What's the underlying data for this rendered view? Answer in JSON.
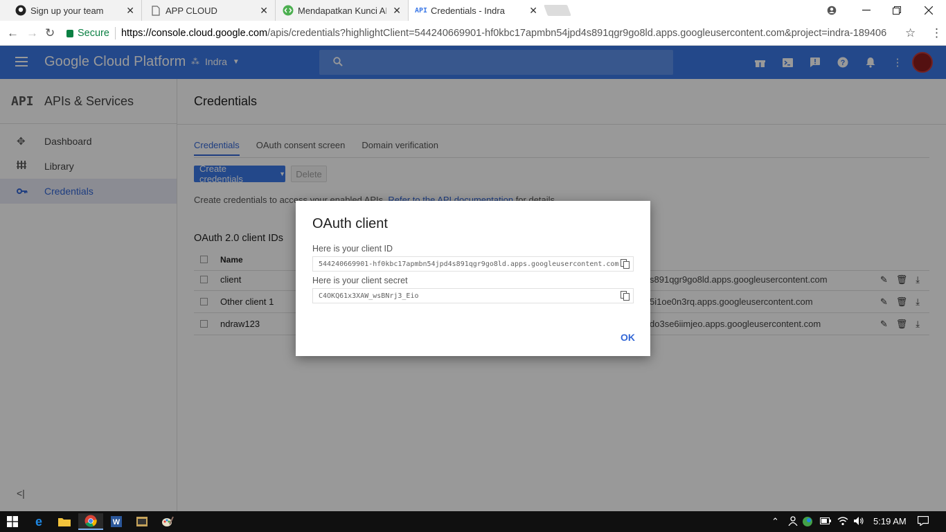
{
  "browser": {
    "tabs": [
      {
        "title": "Sign up your team",
        "icon": "github-icon"
      },
      {
        "title": "APP CLOUD",
        "icon": "document-icon"
      },
      {
        "title": "Mendapatkan Kunci API",
        "icon": "google-dev-icon"
      },
      {
        "title": "Credentials - Indra",
        "icon": "api-icon",
        "active": true
      }
    ],
    "tab_close": "✕",
    "secure_label": "Secure",
    "url_host": "https://console.cloud.google.com",
    "url_rest": "/apis/credentials?highlightClient=544240669901-hf0kbc17apmbn54jpd4s891qgr9go8ld.apps.googleusercontent.com&project=indra-189406"
  },
  "header": {
    "title": "Google Cloud Platform",
    "project": "Indra",
    "accent_color": "#3b78e7"
  },
  "sidebar": {
    "api_badge": "API",
    "title": "APIs & Services",
    "items": [
      {
        "label": "Dashboard",
        "icon": "dashboard-icon"
      },
      {
        "label": "Library",
        "icon": "library-icon"
      },
      {
        "label": "Credentials",
        "icon": "key-icon",
        "active": true
      }
    ]
  },
  "main": {
    "title": "Credentials",
    "tabs": [
      "Credentials",
      "OAuth consent screen",
      "Domain verification"
    ],
    "create_button": "Create credentials",
    "delete_button": "Delete",
    "help_prefix": "Create credentials to access your enabled APIs.",
    "help_link": "Refer to the API documentation",
    "help_suffix": "for details.",
    "section_title": "OAuth 2.0 client IDs",
    "table": {
      "header": "Name",
      "rows": [
        {
          "name": "client",
          "client_id": "s891qgr9go8ld.apps.googleusercontent.com"
        },
        {
          "name": "Other client 1",
          "client_id": "5i1oe0n3rq.apps.googleusercontent.com"
        },
        {
          "name": "ndraw123",
          "client_id": "do3se6iimjeo.apps.googleusercontent.com"
        }
      ]
    }
  },
  "dialog": {
    "title": "OAuth client",
    "client_id_label": "Here is your client ID",
    "client_id": "544240669901-hf0kbc17apmbn54jpd4s891qgr9go8ld.apps.googleusercontent.com",
    "client_secret_label": "Here is your client secret",
    "client_secret": "C4OKQ61x3XAW_wsBNrj3_Eio",
    "ok_label": "OK"
  },
  "taskbar": {
    "time": "5:19 AM"
  }
}
